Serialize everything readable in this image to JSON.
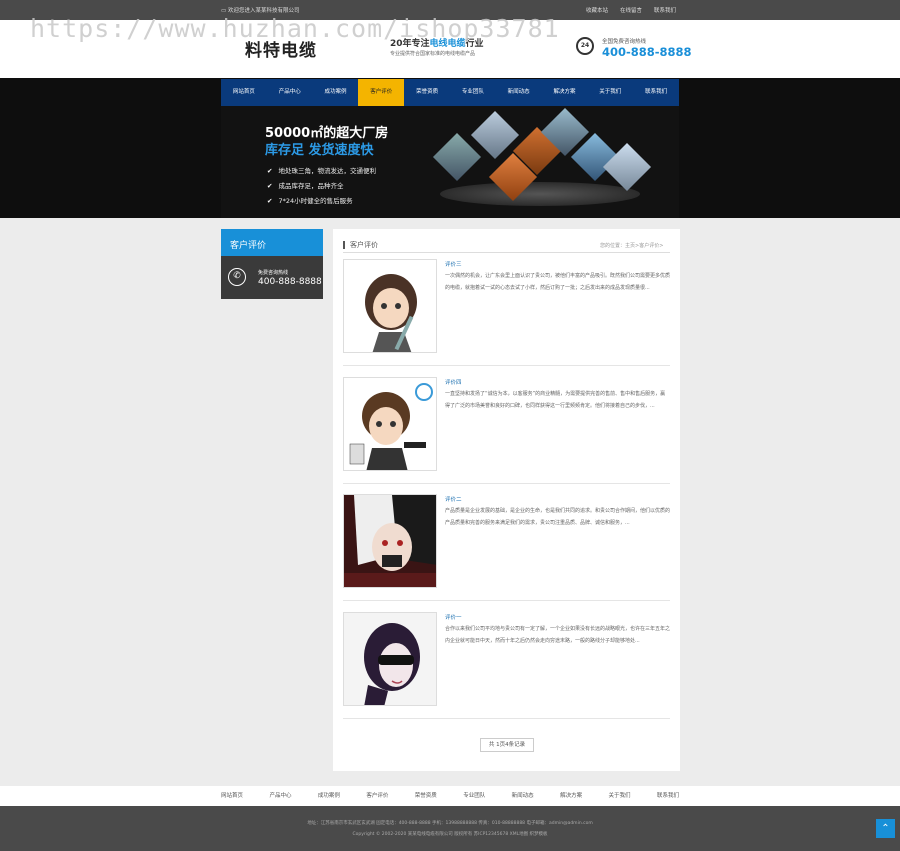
{
  "topbar": {
    "welcome": "欢迎您进入某某科技有限公司",
    "links": [
      "收藏本站",
      "在线留言",
      "联系我们"
    ]
  },
  "header": {
    "logo": "料特电缆",
    "slogan_prefix": "20年专注",
    "slogan_highlight": "电线电缆",
    "slogan_suffix": "行业",
    "slogan_sub": "专业提供符合国家标准的电线电缆产品",
    "phone_badge": "24",
    "hotline_label": "全国免费咨询热线",
    "hotline": "400-888-8888"
  },
  "watermark": "https://www.huzhan.com/ishop33781",
  "nav": {
    "items": [
      "网站首页",
      "产品中心",
      "成功案例",
      "客户评价",
      "荣誉资质",
      "专业团队",
      "新闻动态",
      "解决方案",
      "关于我们",
      "联系我们"
    ],
    "active_index": 3
  },
  "banner": {
    "title": "50000㎡的超大厂房",
    "subtitle": "库存足 发货速度快",
    "features": [
      "地处珠三角，物流发达，交通便利",
      "成品库存足，品种齐全",
      "7*24小时健全的售后服务"
    ]
  },
  "sidebar": {
    "title": "客户评价",
    "hotline_label": "免费咨询热线",
    "hotline": "400-888-8888"
  },
  "main": {
    "section_title": "客户评价",
    "breadcrumb": "您的位置：主页>客户评价>",
    "items": [
      {
        "title": "评价三",
        "text": "一次偶然的机会，让广东会里上面认识了贵公司，被他们丰富的产品吸引。既然我们公司需要更多优质的电缆，就抱着试一试的心态去试了小样，然后订购了一批；之后发出来的成品发现质量很..."
      },
      {
        "title": "评价四",
        "text": "一直坚持和发扬了“诚信为本，以客服务”的商业精髓，为需要提供完善的售前、售中和售后服务，赢得了广泛的市场美誉和良好的口碑，也同样获得这一行里频频肯定。他们将接着自己的步伐，..."
      },
      {
        "title": "评价二",
        "text": "产品质量是企业发展的基础，是企业的生命，也是我们共同的追求。和贵公司合作期间，他们以优质的产品质量和完善的服务来满足我们的需求，贵公司注重品质、品牌、诚信和服务，..."
      },
      {
        "title": "评价一",
        "text": "合作以来我们公司平均地与贵公司有一定了解，一个企业如果没有长远的战略眼光，也许在三年五年之内企业就可能日中天，然而十年之后仍然会走向穷途末路，一般的路线分子却能够地处..."
      }
    ],
    "pager": "共 1页4条记录"
  },
  "footer": {
    "nav": [
      "网站首页",
      "产品中心",
      "成功案例",
      "客户评价",
      "荣誉资质",
      "专业团队",
      "新闻动态",
      "解决方案",
      "关于我们",
      "联系我们"
    ],
    "line1": "地址：江苏省南京市玄武区玄武湖 固定电话：400-888-8888  手机：13988888888  传真：010-88888888  电子邮箱：admin@admin.com",
    "line2": "Copyright © 2002-2020 某某电线电缆有限公司 版权所有  苏ICP12345678  XML地图  织梦模板",
    "totop_icon": "arrow-up-icon"
  },
  "colors": {
    "accent": "#1890d8",
    "nav_bg": "#0a3a7c",
    "nav_active": "#f4b400",
    "topbar": "#4a4a4a"
  }
}
